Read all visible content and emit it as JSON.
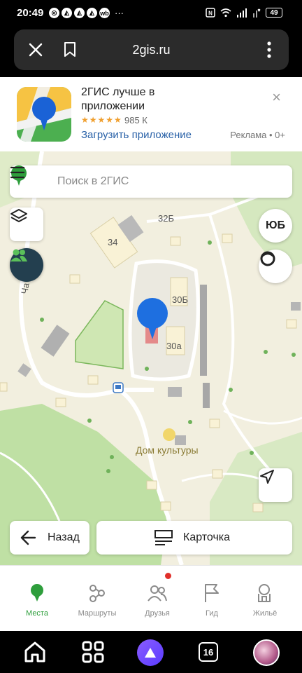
{
  "status_bar": {
    "time": "20:49",
    "left_icons": [
      "◎",
      "◭",
      "◭",
      "◭",
      "wb"
    ],
    "more": "···",
    "battery": "49"
  },
  "browser": {
    "url": "2gis.ru"
  },
  "ad": {
    "title": "2ГИС лучше в приложении",
    "stars": "★★★★★",
    "rating": "985 К",
    "cta": "Загрузить приложение",
    "meta": "Реклама • 0+",
    "close": "×"
  },
  "map": {
    "search_placeholder": "Поиск в 2ГИС",
    "user_initials": "ЮБ",
    "labels": {
      "b34": "34",
      "b32b": "32Б",
      "b30b": "30Б",
      "b30a": "30а",
      "street": "Ча",
      "culture": "Дом культуры"
    },
    "back_label": "Назад",
    "card_label": "Карточка"
  },
  "nav": {
    "items": [
      {
        "label": "Места",
        "icon": "pin-icon"
      },
      {
        "label": "Маршруты",
        "icon": "routes-icon"
      },
      {
        "label": "Друзья",
        "icon": "friends-icon"
      },
      {
        "label": "Гид",
        "icon": "flag-icon"
      },
      {
        "label": "Жильё",
        "icon": "house-icon"
      }
    ]
  },
  "system": {
    "tab_count": "16"
  },
  "colors": {
    "brand_green": "#2e9e3c",
    "pin_blue": "#1e6fe0",
    "link_blue": "#2a62a8",
    "notif_red": "#e0302a"
  }
}
